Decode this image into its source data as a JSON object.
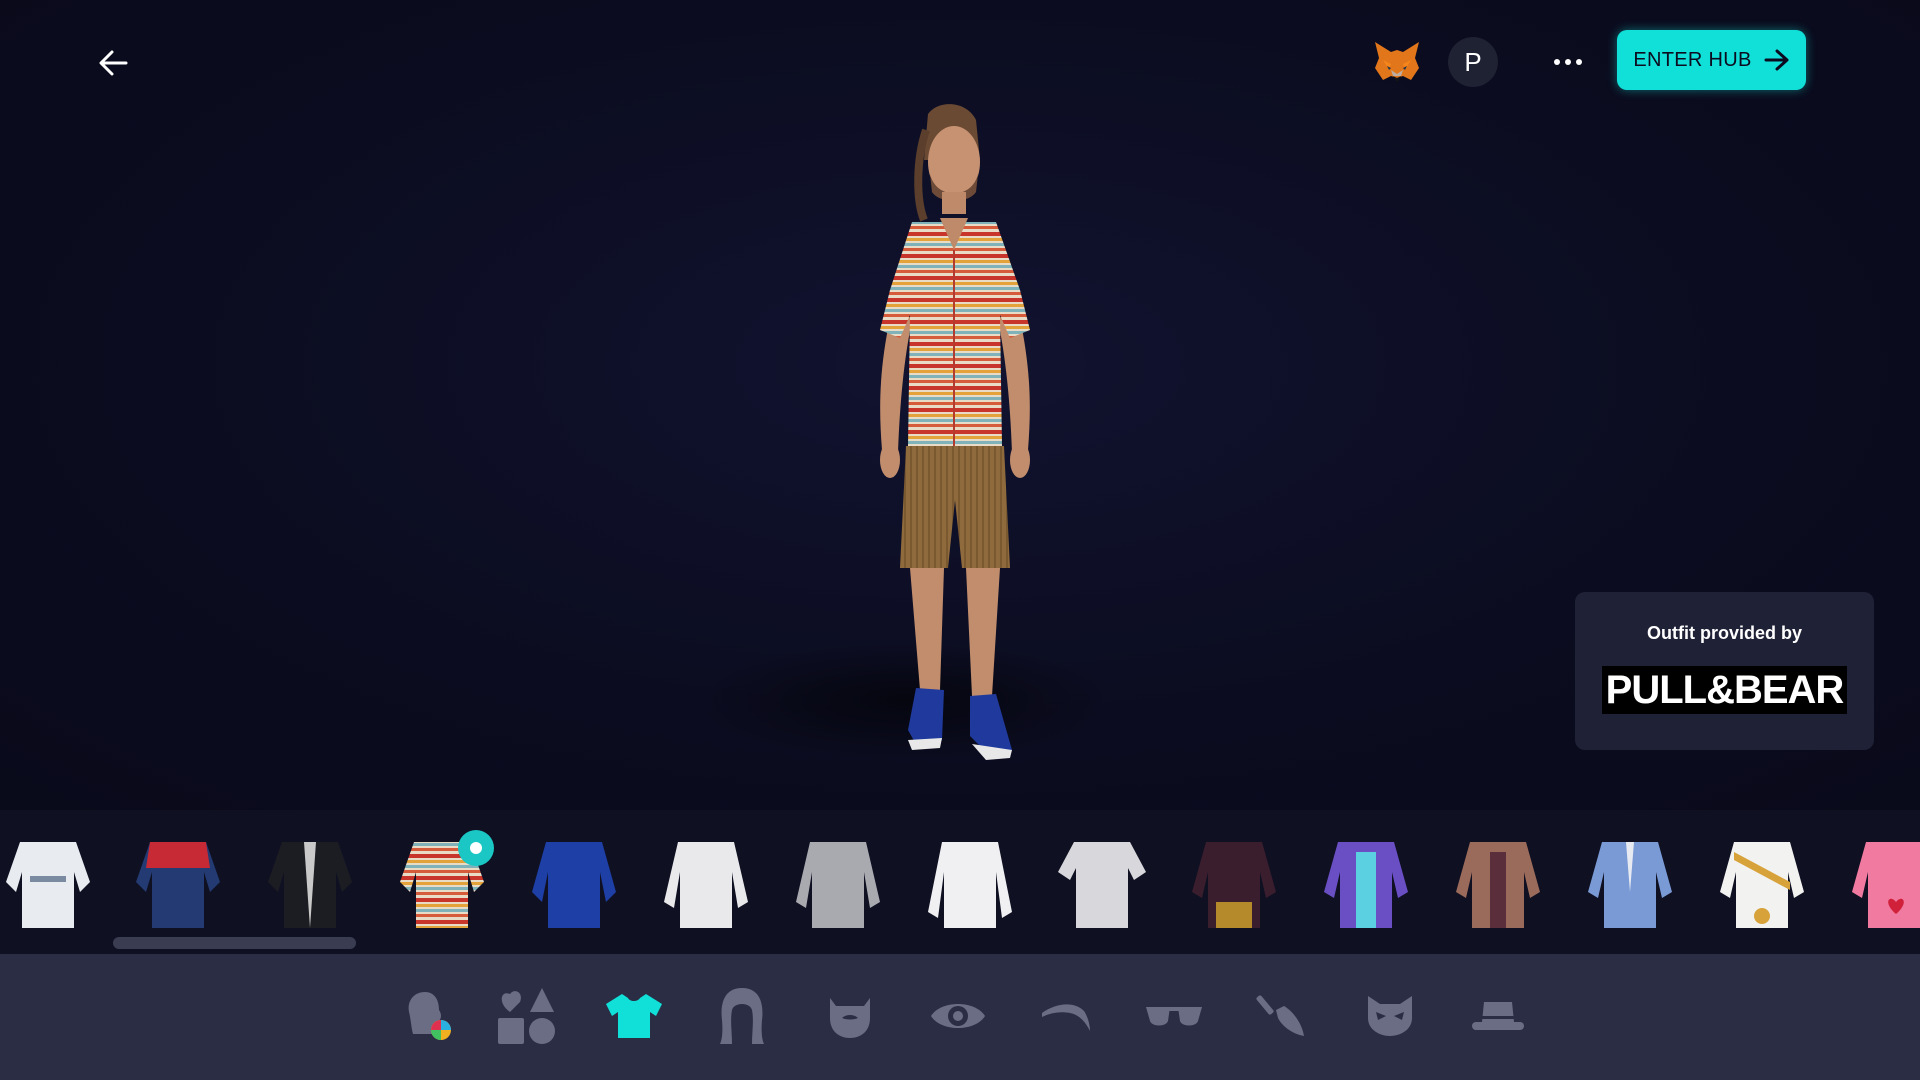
{
  "header": {
    "back_icon": "arrow-left-icon",
    "wallet_icon": "metamask-fox-icon",
    "profile_initial": "P",
    "more_icon": "more-dots-icon",
    "enter_hub_label": "ENTER HUB",
    "enter_hub_icon": "arrow-right-icon"
  },
  "outfit_card": {
    "label": "Outfit provided by",
    "brand": "PULL&BEAR"
  },
  "items": [
    {
      "name": "white-racing-suit",
      "selected": false
    },
    {
      "name": "red-navy-track-jacket",
      "selected": false
    },
    {
      "name": "black-leather-jacket",
      "selected": false
    },
    {
      "name": "striped-knit-shirt",
      "selected": true
    },
    {
      "name": "blue-hoodie",
      "selected": false
    },
    {
      "name": "white-sweatshirt",
      "selected": false
    },
    {
      "name": "grey-hoodie",
      "selected": false
    },
    {
      "name": "white-lab-coat",
      "selected": false
    },
    {
      "name": "grey-tshirt",
      "selected": false
    },
    {
      "name": "plaid-shirt",
      "selected": false
    },
    {
      "name": "purple-jacket",
      "selected": false
    },
    {
      "name": "brown-suit",
      "selected": false
    },
    {
      "name": "light-blue-suit",
      "selected": false
    },
    {
      "name": "gold-armor",
      "selected": false
    },
    {
      "name": "pink-costume",
      "selected": false
    }
  ],
  "categories": [
    {
      "icon": "skin-color-icon",
      "active": false
    },
    {
      "icon": "body-shape-icon",
      "active": false
    },
    {
      "icon": "tshirt-icon",
      "active": true
    },
    {
      "icon": "hair-icon",
      "active": false
    },
    {
      "icon": "beard-icon",
      "active": false
    },
    {
      "icon": "eye-icon",
      "active": false
    },
    {
      "icon": "eyebrow-icon",
      "active": false
    },
    {
      "icon": "glasses-icon",
      "active": false
    },
    {
      "icon": "makeup-brush-icon",
      "active": false
    },
    {
      "icon": "mask-icon",
      "active": false
    },
    {
      "icon": "hat-icon",
      "active": false
    }
  ],
  "colors": {
    "accent": "#11e0d8",
    "background": "#0b0c1f",
    "bar": "#2b2d45",
    "icon_inactive": "#6b6d85"
  }
}
